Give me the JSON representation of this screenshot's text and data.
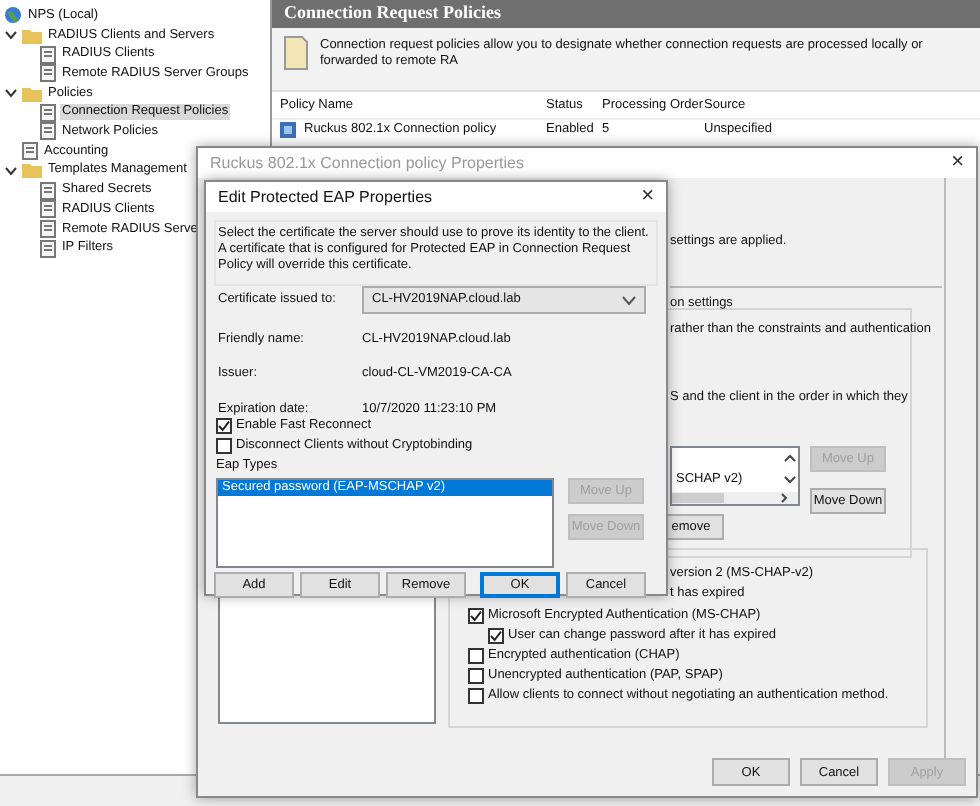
{
  "tree": [
    {
      "label": "NPS (Local)",
      "selected": false,
      "children": [
        {
          "label": "RADIUS Clients and Servers",
          "expanded": true,
          "selected": false,
          "children": [
            {
              "label": "RADIUS Clients",
              "selected": false
            },
            {
              "label": "Remote RADIUS Server Groups",
              "selected": false
            }
          ]
        },
        {
          "label": "Policies",
          "expanded": true,
          "selected": false,
          "children": [
            {
              "label": "Connection Request Policies",
              "selected": true
            },
            {
              "label": "Network Policies",
              "selected": false
            }
          ]
        },
        {
          "label": "Accounting",
          "selected": false
        },
        {
          "label": "Templates Management",
          "expanded": true,
          "selected": false,
          "children": [
            {
              "label": "Shared Secrets",
              "selected": false
            },
            {
              "label": "RADIUS Clients",
              "selected": false
            },
            {
              "label": "Remote RADIUS Serve",
              "selected": false
            },
            {
              "label": "IP Filters",
              "selected": false
            }
          ]
        }
      ]
    }
  ],
  "details": {
    "title": "Connection Request Policies",
    "description": "Connection request policies allow you to designate whether connection requests are processed locally or forwarded to remote RA",
    "columns": [
      "Policy Name",
      "Status",
      "Processing Order",
      "Source"
    ],
    "rows": [
      {
        "cells": [
          "Ruckus 802.1x Connection policy",
          "Enabled",
          "5",
          "Unspecified"
        ]
      }
    ]
  },
  "properties_window": {
    "title": "Ruckus 802.1x Connection policy Properties",
    "close": "×",
    "texts": [
      "settings are applied.",
      "rather than the constraints and authentication",
      "S and the client in the order in which they",
      "version 2 (MS-CHAP-v2)",
      "t has expired"
    ],
    "group_label": "on settings",
    "list_item": "SCHAP v2)",
    "side_buttons": [
      {
        "label": "Move Up",
        "disabled": true
      },
      {
        "label": "Move Down",
        "disabled": false
      }
    ],
    "remove_button": "emove",
    "auth_options": [
      {
        "label": "Microsoft Encrypted Authentication (MS-CHAP)",
        "checked": true,
        "children": [
          {
            "label": "User can change password after it has expired",
            "checked": true
          }
        ]
      },
      {
        "label": "Encrypted authentication (CHAP)",
        "checked": false
      },
      {
        "label": "Unencrypted authentication (PAP, SPAP)",
        "checked": false
      },
      {
        "label": "Allow clients to connect without negotiating an authentication method.",
        "checked": false
      }
    ],
    "buttons": [
      {
        "label": "OK",
        "disabled": false
      },
      {
        "label": "Cancel",
        "disabled": false
      },
      {
        "label": "Apply",
        "disabled": true
      }
    ]
  },
  "eap_dialog": {
    "title": "Edit Protected EAP Properties",
    "close": "×",
    "description": "Select the certificate the server should use to prove its identity to the client. A certificate that is configured for Protected EAP in Connection Request Policy will override this certificate.",
    "fields": [
      {
        "label": "Certificate issued to:",
        "value": "CL-HV2019NAP.cloud.lab",
        "kind": "combo"
      },
      {
        "label": "Friendly name:",
        "value": "CL-HV2019NAP.cloud.lab",
        "kind": "text"
      },
      {
        "label": "Issuer:",
        "value": "cloud-CL-VM2019-CA-CA",
        "kind": "text"
      },
      {
        "label": "Expiration date:",
        "value": "10/7/2020 11:23:10 PM",
        "kind": "text"
      }
    ],
    "checkboxes": [
      {
        "label": "Enable Fast Reconnect",
        "checked": true
      },
      {
        "label": "Disconnect Clients without Cryptobinding",
        "checked": false
      }
    ],
    "eap_types_label": "Eap Types",
    "eap_types": [
      {
        "label": "Secured password (EAP-MSCHAP v2)",
        "selected": true
      }
    ],
    "side_buttons": [
      {
        "label": "Move Up",
        "disabled": true
      },
      {
        "label": "Move Down",
        "disabled": true
      }
    ],
    "buttons": [
      {
        "label": "Add",
        "default": false
      },
      {
        "label": "Edit",
        "default": false
      },
      {
        "label": "Remove",
        "default": false
      },
      {
        "label": "OK",
        "default": true
      },
      {
        "label": "Cancel",
        "default": false
      }
    ]
  }
}
